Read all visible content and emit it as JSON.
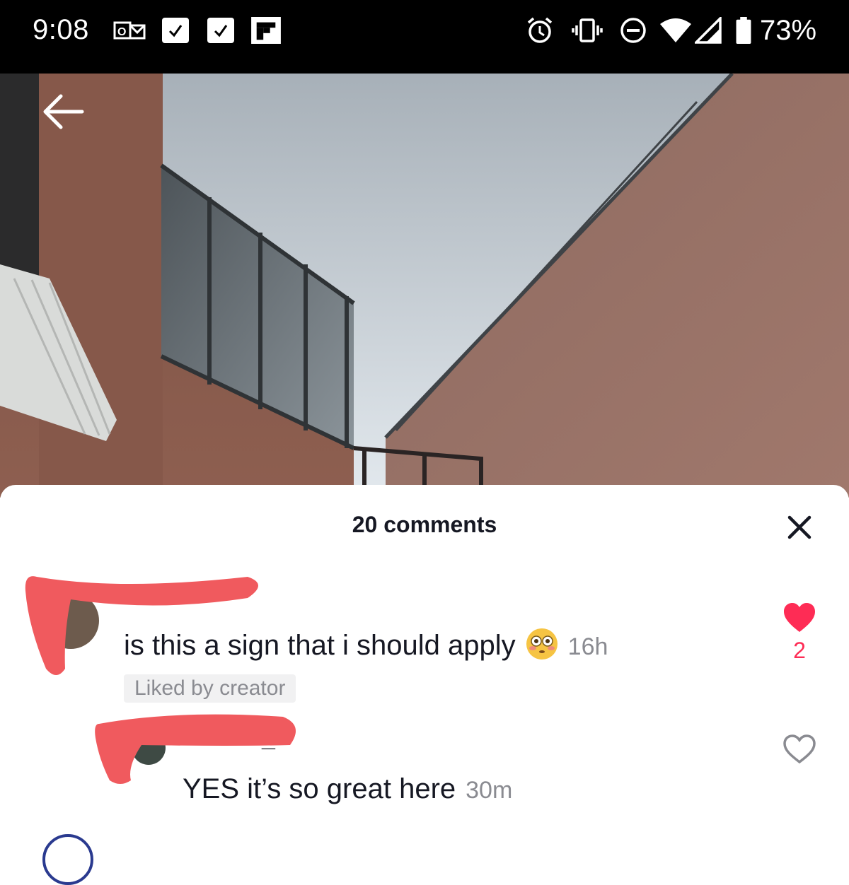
{
  "status_bar": {
    "time": "9:08",
    "battery": "73%",
    "left_icons": [
      "outlook-icon",
      "check-icon",
      "check-icon",
      "flipboard-icon"
    ],
    "right_icons": [
      "alarm-icon",
      "vibrate-icon",
      "dnd-icon",
      "wifi-icon",
      "signal-icon",
      "battery-icon"
    ]
  },
  "comments_sheet": {
    "title": "20 comments",
    "comments": [
      {
        "text": "is this a sign that i should apply",
        "emoji": "flushed-emoji",
        "time": "16h",
        "badge": "Liked by creator",
        "likes": "2",
        "liked": true
      },
      {
        "username": "_",
        "text": "YES it’s so great here",
        "time": "30m",
        "liked": false
      }
    ]
  },
  "colors": {
    "accent": "#fe2c55",
    "redaction": "#f05a5e",
    "text": "#161823",
    "muted": "#8a8b91"
  }
}
